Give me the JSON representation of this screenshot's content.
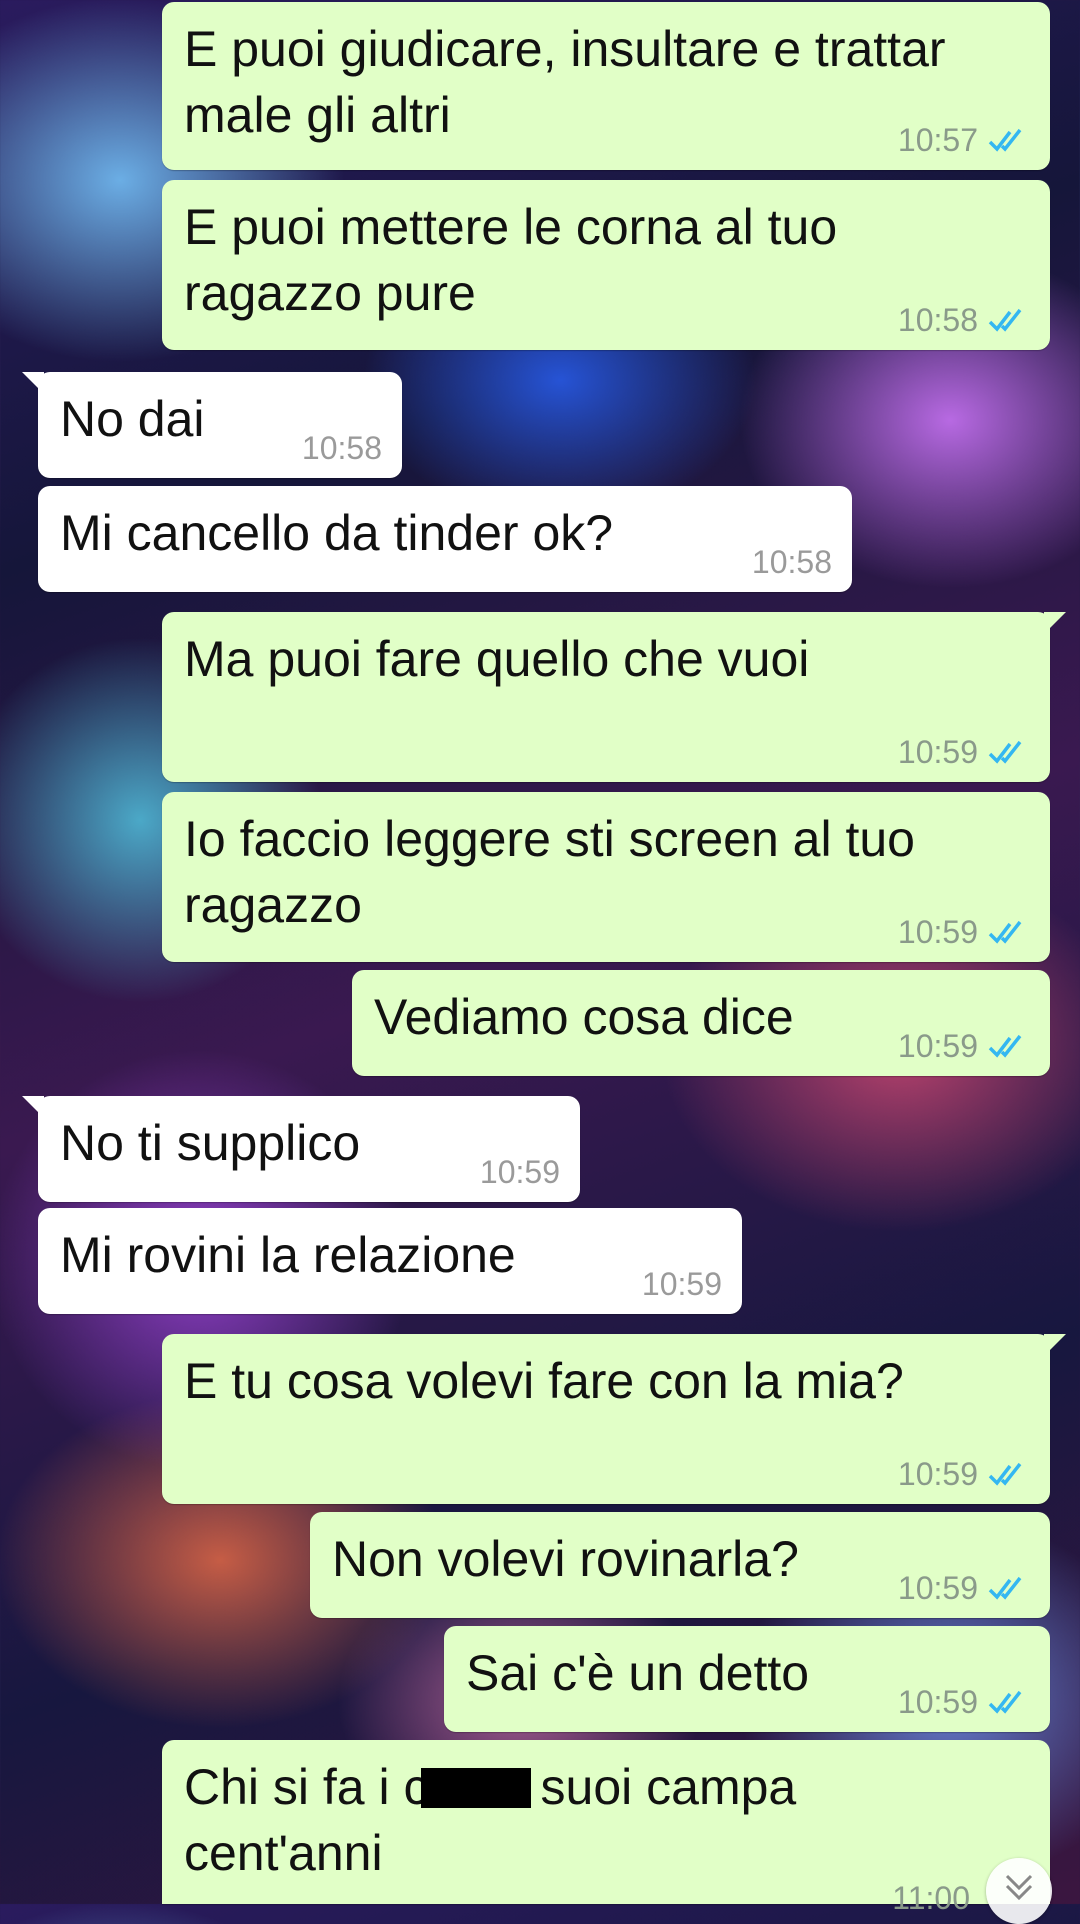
{
  "colors": {
    "outgoing_bubble": "#e1ffc7",
    "incoming_bubble": "#ffffff",
    "read_ticks": "#34b7f1",
    "timestamp": "#8a9a8a"
  },
  "icons": {
    "read_receipt": "double-check-icon",
    "scroll_down": "chevron-down-icon"
  },
  "messages": [
    {
      "direction": "out",
      "text": "E puoi giudicare, insultare e trattar\nmale gli altri",
      "time": "10:57",
      "read": true
    },
    {
      "direction": "out",
      "text": "E puoi mettere le corna al tuo\nragazzo pure",
      "time": "10:58",
      "read": true
    },
    {
      "direction": "in",
      "text": "No dai",
      "time": "10:58"
    },
    {
      "direction": "in",
      "text": "Mi cancello da tinder ok?",
      "time": "10:58"
    },
    {
      "direction": "out",
      "text": "Ma puoi fare quello che vuoi",
      "time": "10:59",
      "read": true
    },
    {
      "direction": "out",
      "text": "Io faccio leggere sti screen al tuo\nragazzo",
      "time": "10:59",
      "read": true
    },
    {
      "direction": "out",
      "text": "Vediamo cosa dice",
      "time": "10:59",
      "read": true
    },
    {
      "direction": "in",
      "text": "No ti supplico",
      "time": "10:59"
    },
    {
      "direction": "in",
      "text": "Mi rovini la relazione",
      "time": "10:59"
    },
    {
      "direction": "out",
      "text": "E tu cosa volevi fare con la mia?",
      "time": "10:59",
      "read": true
    },
    {
      "direction": "out",
      "text": "Non volevi rovinarla?",
      "time": "10:59",
      "read": true
    },
    {
      "direction": "out",
      "text": "Sai c'è un detto",
      "time": "10:59",
      "read": true
    },
    {
      "direction": "out",
      "text_before_redaction": "Chi si fa i c",
      "text_after_redaction": "suoi campa",
      "text_line2": "cent'anni",
      "time": "11:00",
      "read": true
    }
  ]
}
